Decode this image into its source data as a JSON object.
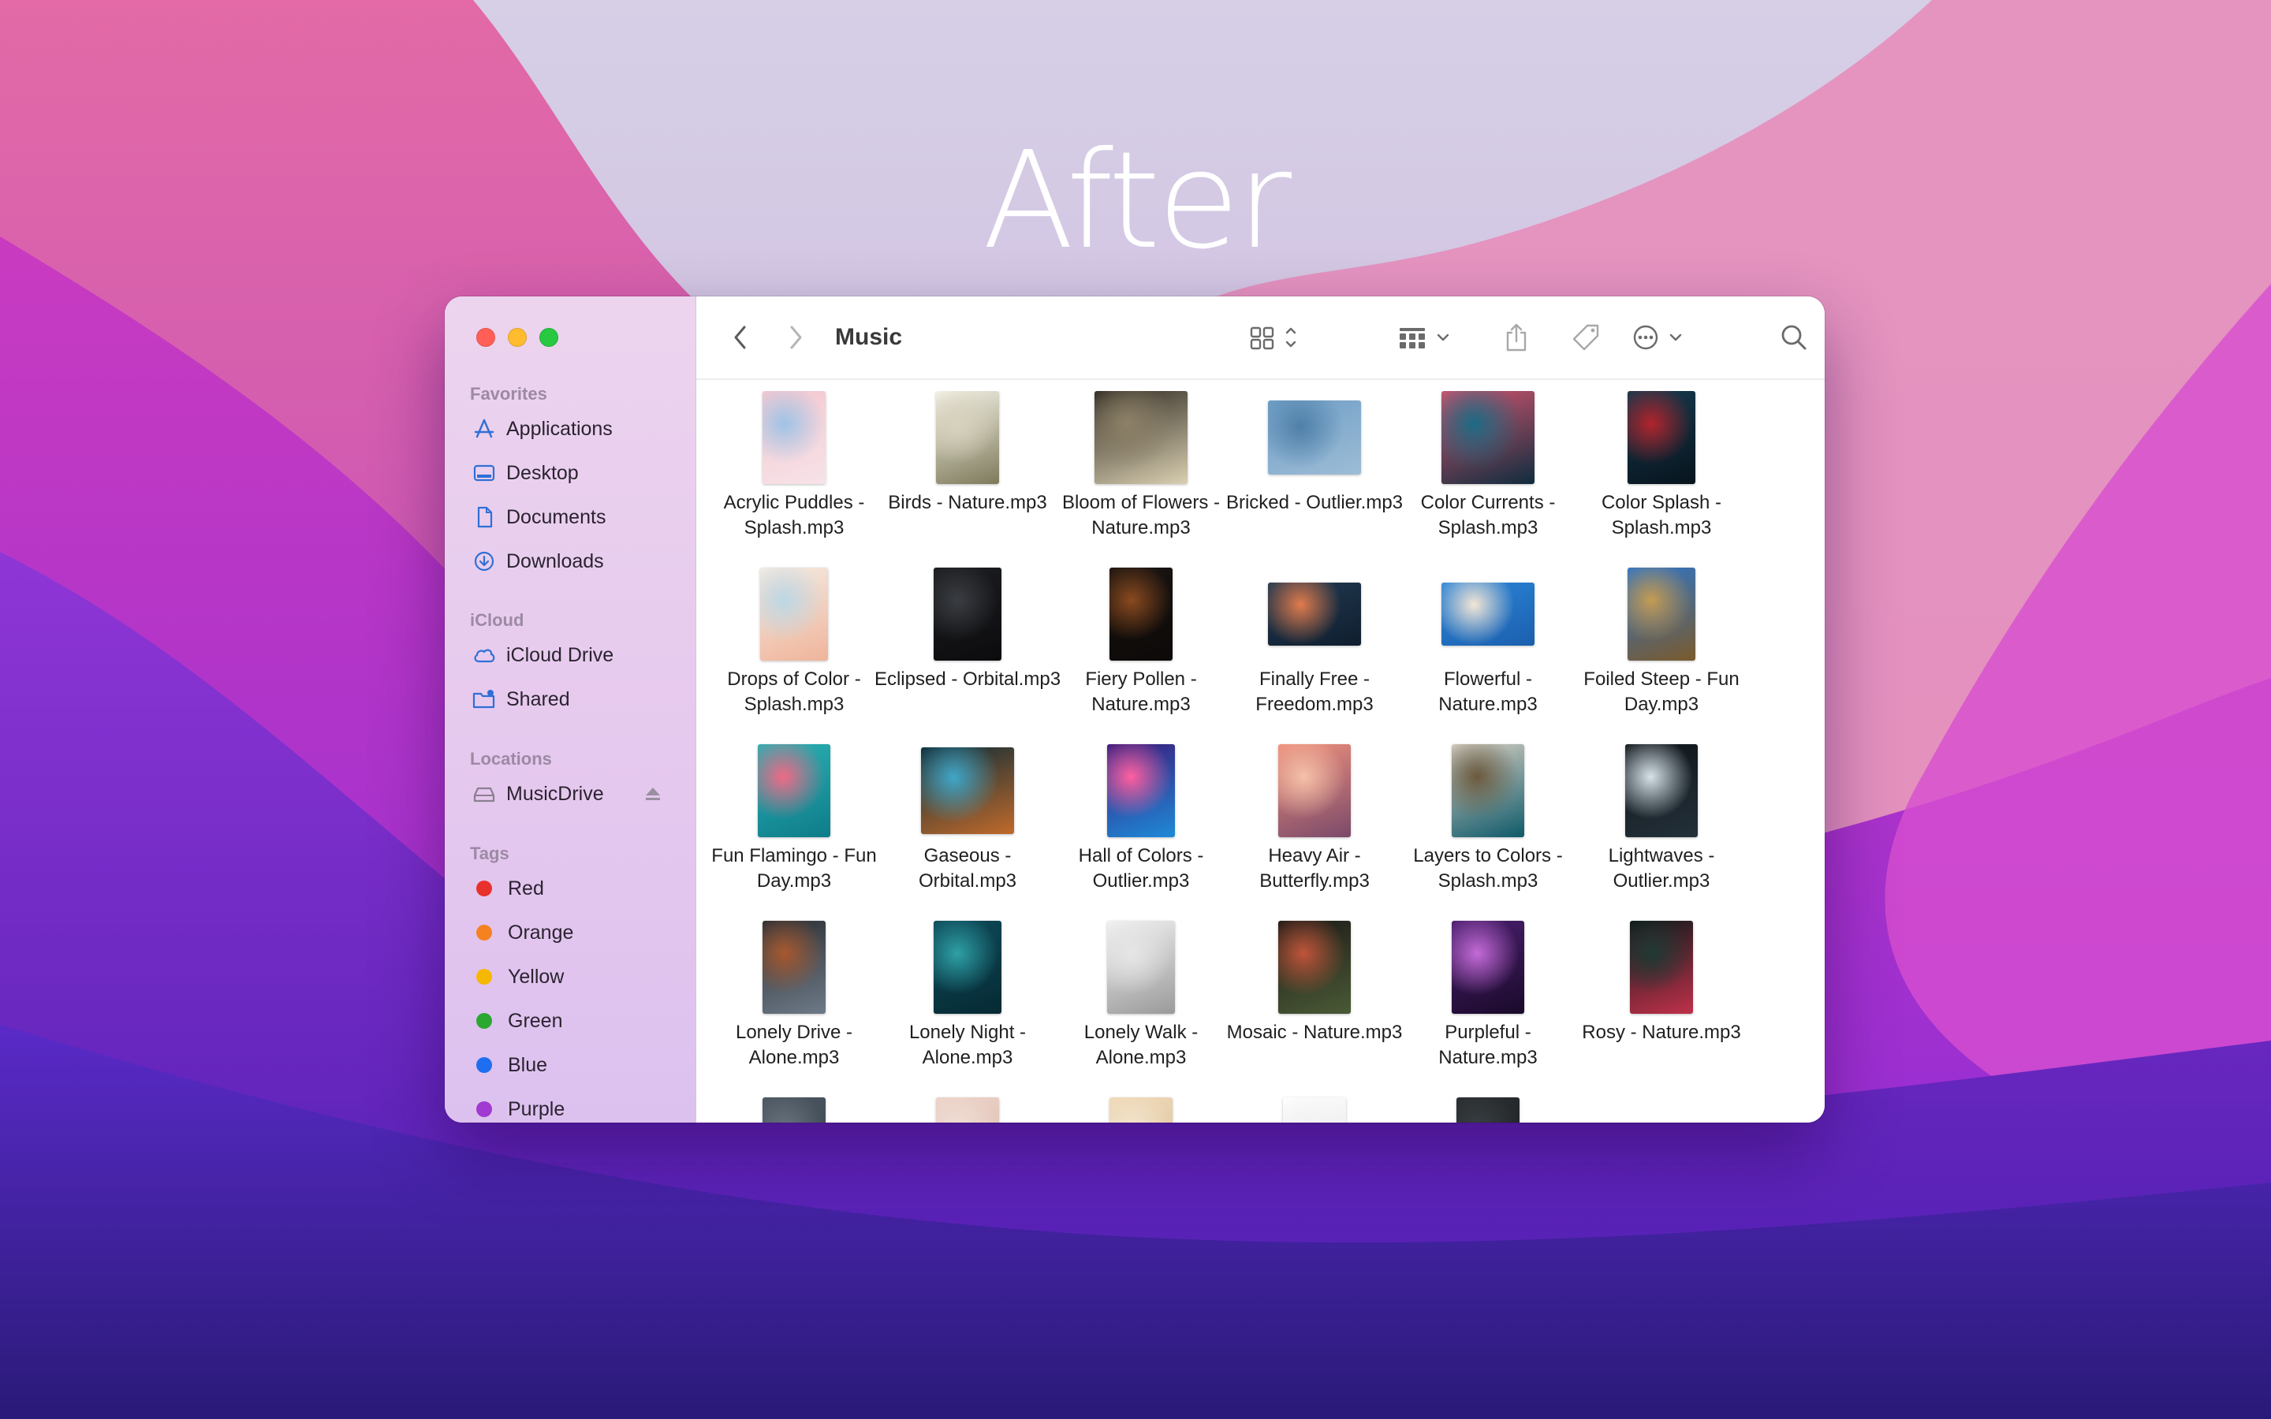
{
  "hero": {
    "title": "After"
  },
  "window": {
    "title": "Music"
  },
  "sidebar": {
    "sections": [
      {
        "heading": "Favorites",
        "items": [
          {
            "label": "Applications",
            "icon": "applications-icon"
          },
          {
            "label": "Desktop",
            "icon": "desktop-icon"
          },
          {
            "label": "Documents",
            "icon": "document-icon"
          },
          {
            "label": "Downloads",
            "icon": "download-icon"
          }
        ]
      },
      {
        "heading": "iCloud",
        "items": [
          {
            "label": "iCloud Drive",
            "icon": "cloud-icon"
          },
          {
            "label": "Shared",
            "icon": "shared-folder-icon"
          }
        ]
      },
      {
        "heading": "Locations",
        "items": [
          {
            "label": "MusicDrive",
            "icon": "drive-icon"
          }
        ]
      },
      {
        "heading": "Tags",
        "items": [
          {
            "label": "Red",
            "color": "#e8302d"
          },
          {
            "label": "Orange",
            "color": "#f58220"
          },
          {
            "label": "Yellow",
            "color": "#f5b700"
          },
          {
            "label": "Green",
            "color": "#2aa832"
          },
          {
            "label": "Blue",
            "color": "#1f6ef0"
          },
          {
            "label": "Purple",
            "color": "#a03ad0"
          }
        ]
      }
    ]
  },
  "toolbar": {
    "icons": [
      "back-chevron-icon",
      "forward-chevron-icon",
      "icon-view-icon",
      "group-by-icon",
      "share-icon",
      "tag-icon",
      "more-actions-icon",
      "search-icon"
    ]
  },
  "files": [
    {
      "name": "Acrylic Puddles - Splash.mp3",
      "colors": [
        "#f4c7cf",
        "#9fc3e6",
        "#f6e3e8"
      ]
    },
    {
      "name": "Birds - Nature.mp3",
      "colors": [
        "#f6f3e8",
        "#d8d2bd",
        "#7d7a5b"
      ]
    },
    {
      "name": "Bloom of Flowers - Nature.mp3",
      "colors": [
        "#2f2a22",
        "#8d8167",
        "#d9cfb1"
      ]
    },
    {
      "name": "Bricked - Outlier.mp3",
      "colors": [
        "#6f9fc6",
        "#4f7fa8",
        "#9dbcd6"
      ]
    },
    {
      "name": "Color Currents - Splash.mp3",
      "colors": [
        "#d2556f",
        "#1c6b84",
        "#0f2c3e"
      ]
    },
    {
      "name": "Color Splash - Splash.mp3",
      "colors": [
        "#173a4f",
        "#b2242c",
        "#07141d"
      ]
    },
    {
      "name": "Drops of Color - Splash.mp3",
      "colors": [
        "#f4ece4",
        "#bcd7e4",
        "#f0b49a"
      ]
    },
    {
      "name": "Eclipsed - Orbital.mp3",
      "colors": [
        "#1c1d20",
        "#3a3d42",
        "#0c0c0e"
      ]
    },
    {
      "name": "Fiery Pollen - Nature.mp3",
      "colors": [
        "#1a1411",
        "#8a4a1f",
        "#0c0908"
      ]
    },
    {
      "name": "Finally Free - Freedom.mp3",
      "colors": [
        "#223a52",
        "#e07b4c",
        "#0f1e2e"
      ]
    },
    {
      "name": "Flowerful - Nature.mp3",
      "colors": [
        "#2c86d8",
        "#f3e6d6",
        "#1b5fae"
      ]
    },
    {
      "name": "Foiled Steep - Fun Day.mp3",
      "colors": [
        "#2e74c8",
        "#c49b52",
        "#7a5a2c"
      ]
    },
    {
      "name": "Fun Flamingo - Fun Day.mp3",
      "colors": [
        "#2bb1b3",
        "#f06a86",
        "#0e7c8a"
      ]
    },
    {
      "name": "Gaseous - Orbital.mp3",
      "colors": [
        "#0a2a36",
        "#3fa7c9",
        "#c06a2b"
      ]
    },
    {
      "name": "Hall of Colors - Outlier.mp3",
      "colors": [
        "#3a1a7a",
        "#ff5fa0",
        "#1e8ad8"
      ]
    },
    {
      "name": "Heavy Air - Butterfly.mp3",
      "colors": [
        "#f0907c",
        "#f5c1a8",
        "#7a4a6a"
      ]
    },
    {
      "name": "Layers to Colors - Splash.mp3",
      "colors": [
        "#d9d0c4",
        "#6b5a3e",
        "#0f5a6a"
      ]
    },
    {
      "name": "Lightwaves - Outlier.mp3",
      "colors": [
        "#0e1418",
        "#d7e3ea",
        "#24313a"
      ]
    },
    {
      "name": "Lonely Drive - Alone.mp3",
      "colors": [
        "#2c2f33",
        "#a7582e",
        "#6d7a88"
      ]
    },
    {
      "name": "Lonely Night - Alone.mp3",
      "colors": [
        "#0e4a5a",
        "#2ea0a6",
        "#062a33"
      ]
    },
    {
      "name": "Lonely Walk - Alone.mp3",
      "colors": [
        "#f2f2f2",
        "#e6e6e6",
        "#9a9a9a"
      ]
    },
    {
      "name": "Mosaic - Nature.mp3",
      "colors": [
        "#1d1a16",
        "#c0543a",
        "#4a5a36"
      ]
    },
    {
      "name": "Purpleful - Nature.mp3",
      "colors": [
        "#4a1f6e",
        "#c46bd8",
        "#1a0a2a"
      ]
    },
    {
      "name": "Rosy - Nature.mp3",
      "colors": [
        "#0d1a1a",
        "#1f3a34",
        "#c0304a"
      ]
    },
    {
      "name": "",
      "colors": [
        "#4a5560",
        "#6a7580",
        "#3a444e"
      ]
    },
    {
      "name": "",
      "colors": [
        "#ecd2c8",
        "#f0dfd6",
        "#d9b8ab"
      ]
    },
    {
      "name": "",
      "colors": [
        "#efd9b8",
        "#f4e6cf",
        "#d8bd95"
      ]
    },
    {
      "name": "",
      "colors": [
        "#ffffff",
        "#f2f2f2",
        "#dcdcdc"
      ]
    },
    {
      "name": "",
      "colors": [
        "#2a2e30",
        "#3a4044",
        "#1a1d1f"
      ]
    }
  ]
}
